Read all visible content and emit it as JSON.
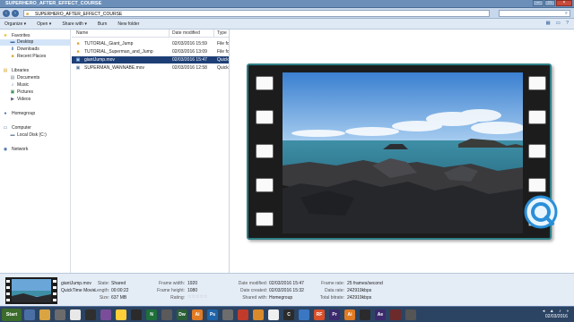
{
  "window": {
    "title": "SUPERHERO_AFTER_EFFECT_COURSE",
    "minimize": "–",
    "maximize": "□",
    "close": "×"
  },
  "address": {
    "back": "‹",
    "forward": "›",
    "path": "SUPERHERO_AFTER_EFFECT_COURSE",
    "search_icon": "⌕"
  },
  "toolbar": {
    "organize": "Organize ▾",
    "open": "Open ▾",
    "share_with": "Share with ▾",
    "burn": "Burn",
    "new_folder": "New folder"
  },
  "nav": {
    "favorites": "Favorites",
    "desktop": "Desktop",
    "downloads": "Downloads",
    "recent_places": "Recent Places",
    "libraries": "Libraries",
    "documents": "Documents",
    "music": "Music",
    "pictures": "Pictures",
    "videos": "Videos",
    "homegroup": "Homegroup",
    "computer": "Computer",
    "local_disk": "Local Disk (C:)",
    "network": "Network"
  },
  "columns": {
    "name": "Name",
    "date": "Date modified",
    "type": "Type"
  },
  "files": [
    {
      "name": "TUTORIAL_Giant_Jump",
      "date": "02/03/2016 15:59",
      "type": "File fo",
      "kind": "folder"
    },
    {
      "name": "TUTORIAL_Superman_and_Jump",
      "date": "02/03/2016 13:09",
      "type": "File fo",
      "kind": "folder"
    },
    {
      "name": "giantJump.mov",
      "date": "02/03/2016 15:47",
      "type": "Quick",
      "kind": "movie"
    },
    {
      "name": "SUPERMAN_WANNABE.mov",
      "date": "02/03/2016 12:58",
      "type": "Quick",
      "kind": "movie"
    }
  ],
  "details": {
    "filename": "giantJump.mov",
    "filetype": "QuickTime Movie",
    "state_label": "State:",
    "state": "Shared",
    "length_label": "Length:",
    "length": "00:00:22",
    "size_label": "Size:",
    "size": "637 MB",
    "frame_width_label": "Frame width:",
    "frame_width": "1920",
    "frame_height_label": "Frame height:",
    "frame_height": "1080",
    "rating_label": "Rating:",
    "rating": "☆☆☆☆☆",
    "date_modified_label": "Date modified:",
    "date_modified": "02/03/2016 15:47",
    "date_created_label": "Date created:",
    "date_created": "02/03/2016 15:32",
    "shared_with_label": "Shared with:",
    "shared_with": "Homegroup",
    "frame_rate_label": "Frame rate:",
    "frame_rate": "25 frames/second",
    "data_rate_label": "Data rate:",
    "data_rate": "242919kbps",
    "total_bitrate_label": "Total bitrate:",
    "total_bitrate": "242919kbps"
  },
  "taskbar": {
    "start": "Start",
    "apps": [
      "",
      "",
      "",
      "",
      "",
      "",
      "",
      "",
      "N",
      "",
      "Dw",
      "Ai",
      "Ps",
      "",
      "",
      "",
      "",
      "C",
      "",
      "RF",
      "Pr",
      "Ai",
      "",
      "Ae",
      "",
      ""
    ],
    "clock_date": "02/03/2016"
  },
  "colors": {
    "accent": "#1e3f76",
    "film_border": "#2e7f86",
    "taskbar": "#2c4463"
  }
}
